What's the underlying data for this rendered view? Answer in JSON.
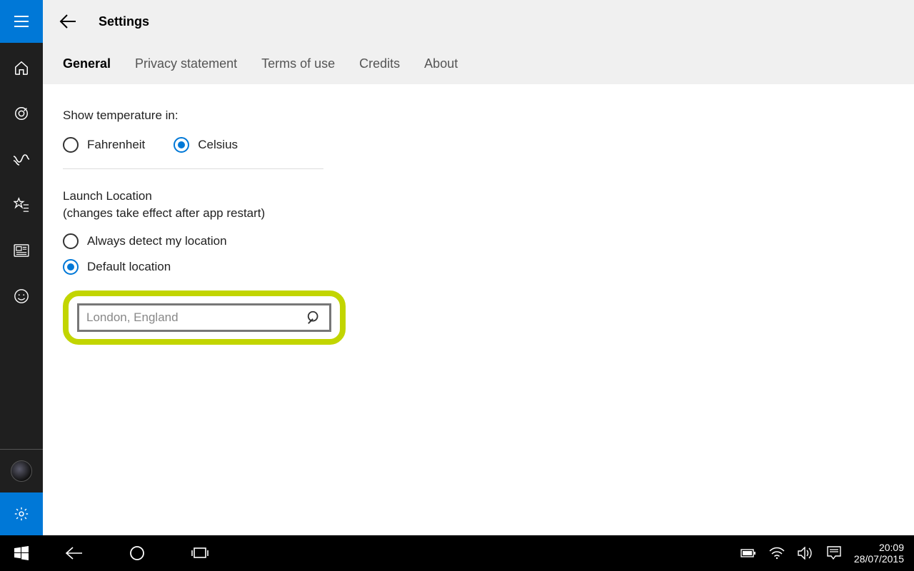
{
  "header": {
    "title": "Settings"
  },
  "tabs": {
    "general": "General",
    "privacy": "Privacy statement",
    "terms": "Terms of use",
    "credits": "Credits",
    "about": "About"
  },
  "temperature": {
    "label": "Show temperature in:",
    "fahrenheit": "Fahrenheit",
    "celsius": "Celsius",
    "selected": "celsius"
  },
  "launch": {
    "label": "Launch Location",
    "note": "(changes take effect after app restart)",
    "always_detect": "Always detect my location",
    "default_location": "Default location",
    "selected": "default",
    "search_placeholder": "London, England",
    "search_value": ""
  },
  "taskbar": {
    "time": "20:09",
    "date": "28/07/2015"
  }
}
